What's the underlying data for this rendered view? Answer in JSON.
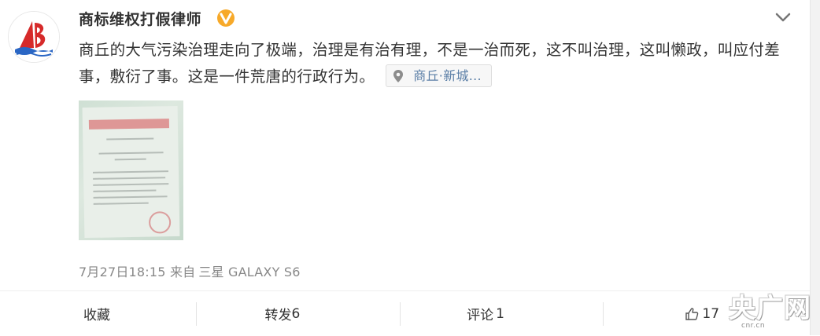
{
  "post": {
    "author": "商标维权打假律师",
    "verified_badge_color": "#f7a929",
    "text": "商丘的大气污染治理走向了极端，治理是有治有理，不是一治而死，这不叫治理，这叫懒政，叫应付差事，敷衍了事。这是一件荒唐的行政行为。",
    "location": "商丘·新城...",
    "location_icon": "map-pin-icon",
    "image_alt_icon": "document-photo",
    "timestamp": "7月27日18:15",
    "source_prefix": "来自",
    "source": "三星 GALAXY S6"
  },
  "actions": {
    "favorite_label": "收藏",
    "repost_label": "转发",
    "repost_count": "6",
    "comment_label": "评论",
    "comment_count": "1",
    "like_count": "17"
  },
  "watermark": {
    "text": "央广网",
    "url": "cnr.cn"
  },
  "colors": {
    "text": "#333333",
    "meta": "#888888",
    "link": "#5a7ea6",
    "badge": "#f7a929"
  }
}
